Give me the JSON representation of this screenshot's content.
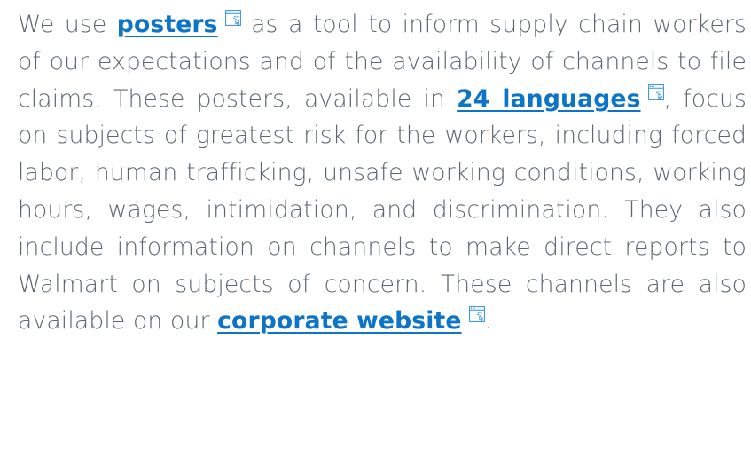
{
  "paragraph": {
    "seg1": "We use ",
    "link_posters": "posters",
    "seg2": " as a tool to inform supply chain workers of our expectations and of the availability of channels to file claims. These posters, available in ",
    "link_languages": "24 languages",
    "seg3": ", focus on subjects of greatest risk for the workers, including forced labor, human trafficking, unsafe working conditions, working hours, wages, intimidation, and discrimination. They also include information on channels to make direct reports to Walmart on subjects of concern. These channels are also available on our ",
    "link_website": "corporate website",
    "seg4": "."
  },
  "icons": {
    "external_link": "external-link-window-cursor-icon"
  },
  "colors": {
    "text": "#5d6770",
    "link": "#0d74c7",
    "icon": "#2d8fd6"
  }
}
